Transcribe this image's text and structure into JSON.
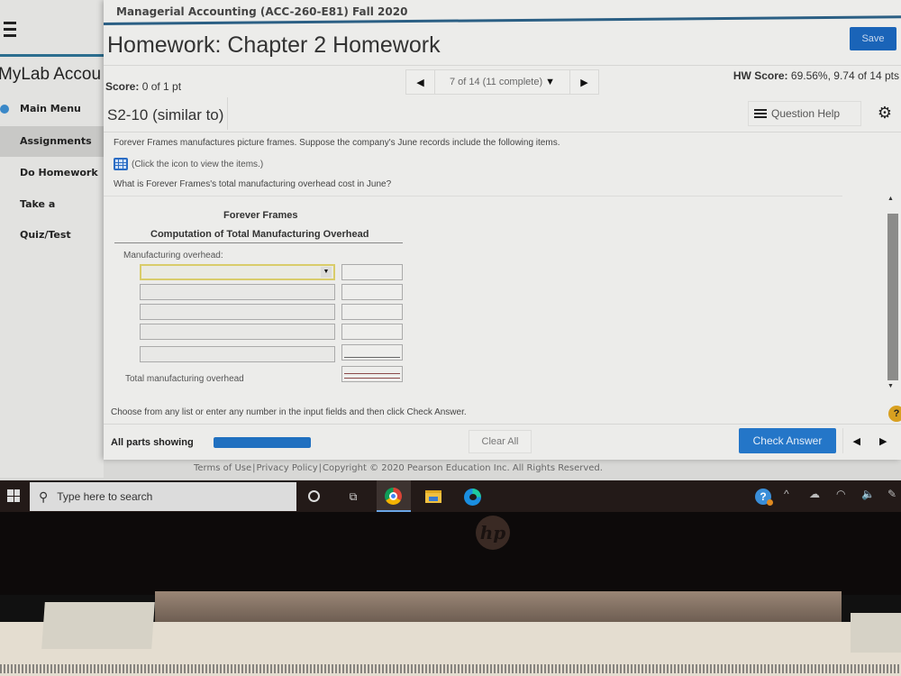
{
  "course_title": "Managerial Accounting (ACC-260-E81) Fall 2020",
  "sidebar": {
    "brand": "MyLab Accou",
    "items": [
      {
        "label": "Main Menu",
        "icon": "back-arrow-icon"
      },
      {
        "label": "Assignments",
        "active": true
      },
      {
        "label": "Do Homework"
      },
      {
        "label": "Take a Quiz/Test"
      }
    ]
  },
  "header": {
    "title": "Homework: Chapter 2 Homework",
    "save_label": "Save"
  },
  "score": {
    "label": "Score:",
    "value": "0 of 1 pt"
  },
  "question_nav": {
    "label": "7 of 14 (11 complete)"
  },
  "hw_score": {
    "label": "HW Score:",
    "value": "69.56%, 9.74 of 14 pts"
  },
  "question": {
    "id": "S2-10 (similar to)",
    "help_label": "Question Help",
    "intro": "Forever Frames manufactures picture frames. Suppose the company's June records include the following items.",
    "click_hint": "(Click the icon to view the items.)",
    "prompt": "What is Forever Frames's total manufacturing overhead cost in June?"
  },
  "table": {
    "company": "Forever Frames",
    "title": "Computation of Total Manufacturing Overhead",
    "section_label": "Manufacturing overhead:",
    "rows": [
      {
        "item": "",
        "amount": ""
      },
      {
        "item": "",
        "amount": ""
      },
      {
        "item": "",
        "amount": ""
      },
      {
        "item": "",
        "amount": ""
      },
      {
        "item": "",
        "amount": ""
      }
    ],
    "total_label": "Total manufacturing overhead",
    "total_amount": ""
  },
  "instructions": "Choose from any list or enter any number in the input fields and then click Check Answer.",
  "footer": {
    "parts_label": "All parts showing",
    "parts_progress": 1.0,
    "clear_label": "Clear All",
    "check_label": "Check Answer"
  },
  "legal": {
    "terms": "Terms of Use",
    "privacy": "Privacy Policy",
    "copyright": "Copyright © 2020 Pearson Education Inc. All Rights Reserved."
  },
  "taskbar": {
    "search_placeholder": "Type here to search"
  },
  "colors": {
    "accent": "#2476c8",
    "save": "#1a64b8",
    "rule": "#2b5f84"
  }
}
